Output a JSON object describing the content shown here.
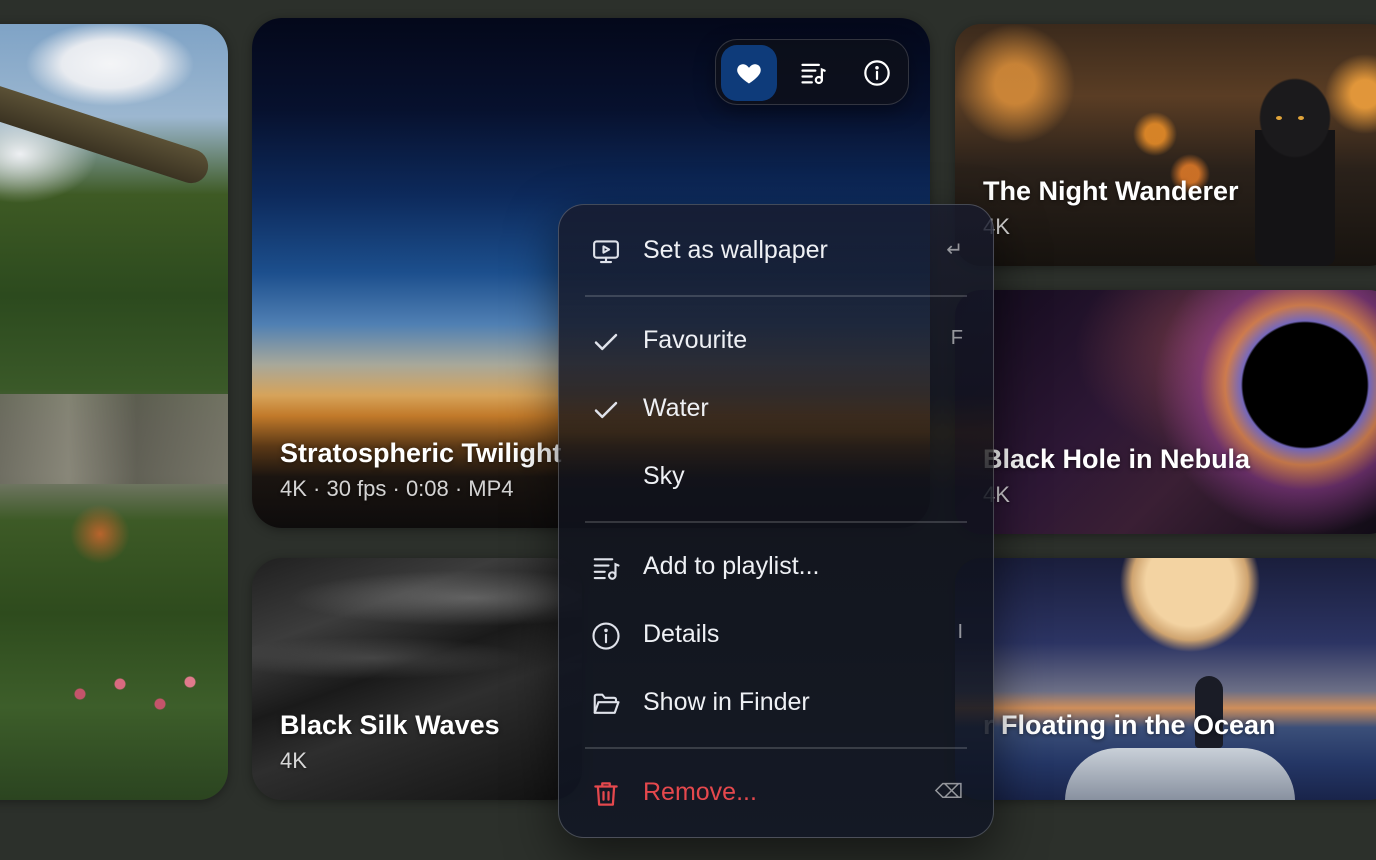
{
  "toolbar": {
    "buttons": [
      {
        "name": "favourite",
        "icon": "heart-icon",
        "active": true
      },
      {
        "name": "playlist",
        "icon": "playlist-icon",
        "active": false
      },
      {
        "name": "info",
        "icon": "info-icon",
        "active": false
      }
    ],
    "accent_color": "#0e3b7a"
  },
  "cards": {
    "stratospheric": {
      "title": "Stratospheric Twilight",
      "meta": "4K · 30 fps · 0:08 · MP4"
    },
    "silk": {
      "title": "Black Silk Waves",
      "meta": "4K"
    },
    "night": {
      "title": "The Night Wanderer",
      "meta": "4K"
    },
    "hole": {
      "title": "Black Hole in Nebula",
      "meta": "4K"
    },
    "float": {
      "title": "r Floating in the Ocean"
    }
  },
  "context_menu": {
    "set_wallpaper": {
      "label": "Set as wallpaper",
      "shortcut": "↵",
      "icon": "monitor-play-icon"
    },
    "favourite": {
      "label": "Favourite",
      "shortcut": "F",
      "checked": true
    },
    "water": {
      "label": "Water",
      "checked": true
    },
    "sky": {
      "label": "Sky",
      "checked": false
    },
    "add_playlist": {
      "label": "Add to playlist...",
      "icon": "playlist-icon"
    },
    "details": {
      "label": "Details",
      "shortcut": "I",
      "icon": "info-icon"
    },
    "show_finder": {
      "label": "Show in Finder",
      "icon": "folder-open-icon"
    },
    "remove": {
      "label": "Remove...",
      "shortcut": "⌫",
      "icon": "trash-icon",
      "color": "#e5484d"
    }
  }
}
